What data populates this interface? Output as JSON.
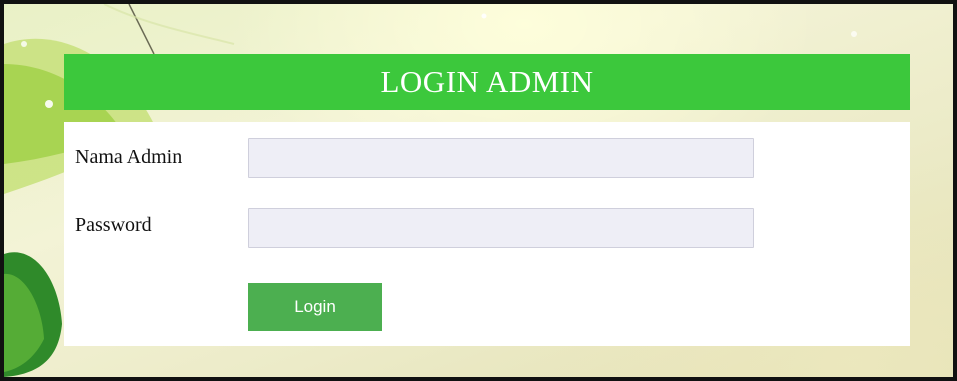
{
  "header": {
    "title": "LOGIN ADMIN"
  },
  "form": {
    "username_label": "Nama Admin",
    "username_value": "",
    "password_label": "Password",
    "password_value": "",
    "submit_label": "Login"
  },
  "colors": {
    "banner": "#3cc83c",
    "button": "#4caf50",
    "input_bg": "#eeeef6"
  }
}
